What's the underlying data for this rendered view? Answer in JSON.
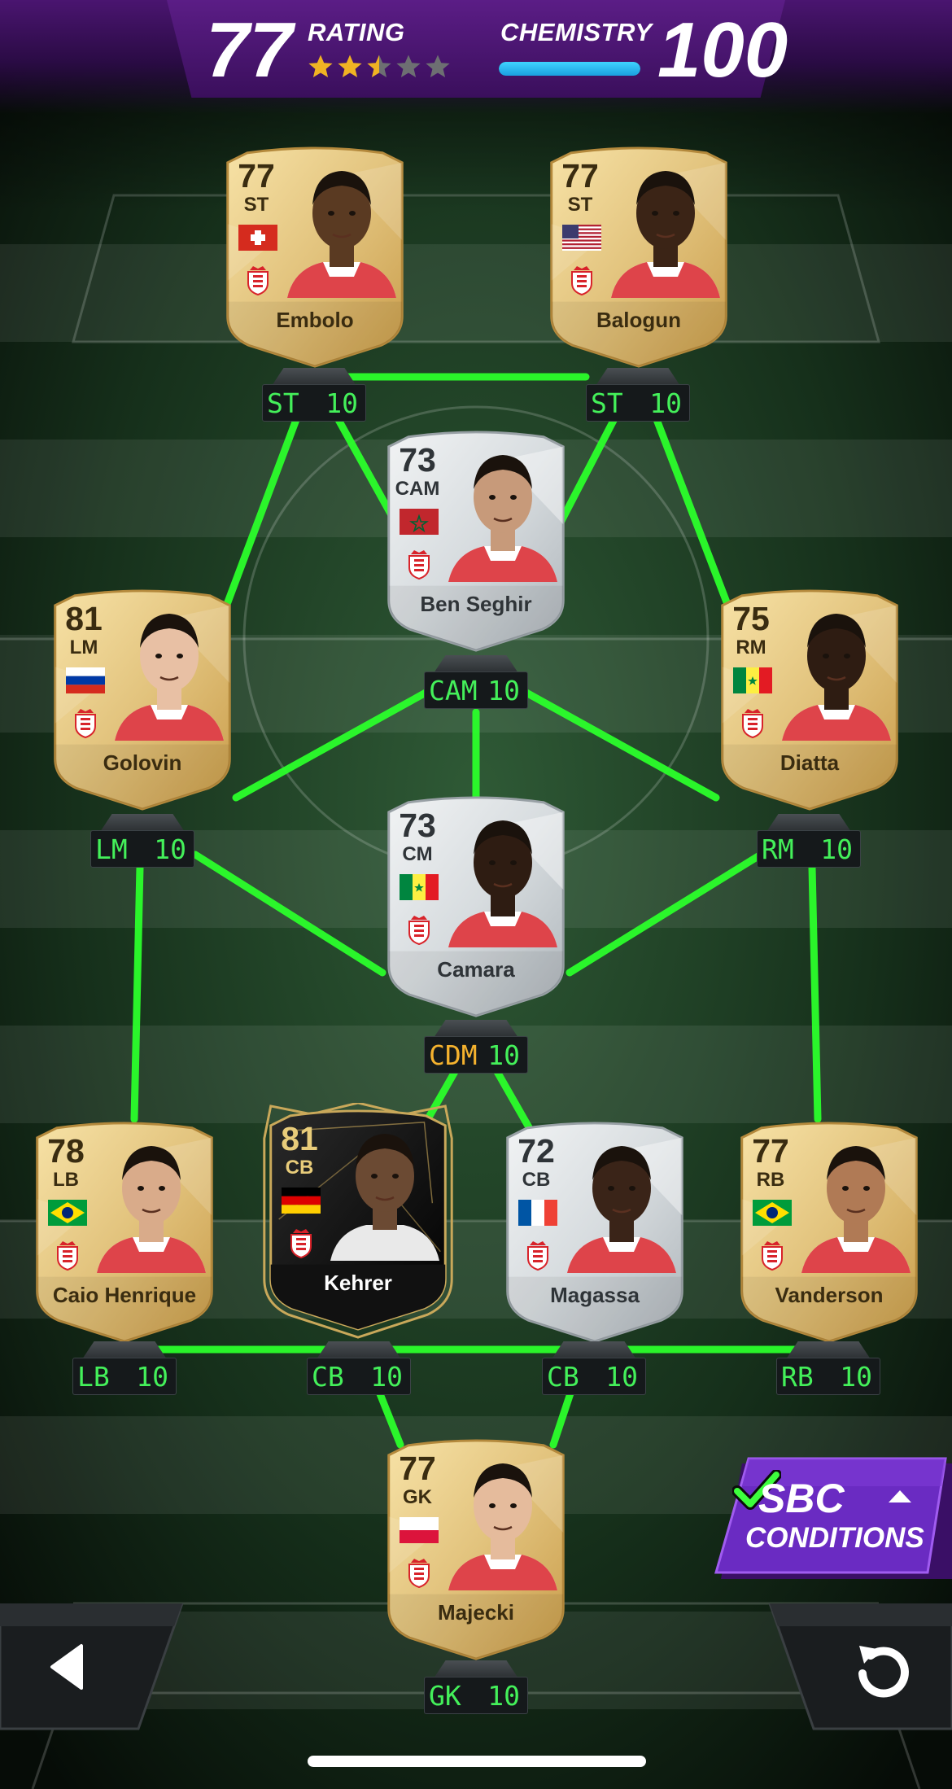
{
  "header": {
    "rating_value": "77",
    "rating_label": "RATING",
    "stars": 2.5,
    "chemistry_label": "CHEMISTRY",
    "chemistry_value": "100",
    "chemistry_fill": 1.0
  },
  "players": [
    {
      "key": "embolo",
      "name": "Embolo",
      "rating": "77",
      "pos": "ST",
      "flag": "switzerland",
      "card": "gold",
      "slot": "ST",
      "chem": "10",
      "skin": "#5a3a22"
    },
    {
      "key": "balogun",
      "name": "Balogun",
      "rating": "77",
      "pos": "ST",
      "flag": "usa",
      "card": "gold",
      "slot": "ST",
      "chem": "10",
      "skin": "#3b2416"
    },
    {
      "key": "benseghir",
      "name": "Ben Seghir",
      "rating": "73",
      "pos": "CAM",
      "flag": "morocco",
      "card": "silver",
      "slot": "CAM",
      "chem": "10",
      "skin": "#c79a7a"
    },
    {
      "key": "golovin",
      "name": "Golovin",
      "rating": "81",
      "pos": "LM",
      "flag": "russia",
      "card": "gold",
      "slot": "LM",
      "chem": "10",
      "skin": "#e8c0a4"
    },
    {
      "key": "diatta",
      "name": "Diatta",
      "rating": "75",
      "pos": "RM",
      "flag": "senegal",
      "card": "gold",
      "slot": "RM",
      "chem": "10",
      "skin": "#2e1c12"
    },
    {
      "key": "camara",
      "name": "Camara",
      "rating": "73",
      "pos": "CM",
      "flag": "senegal",
      "card": "silver",
      "slot": "CDM",
      "chem": "10",
      "skin": "#2e1c12"
    },
    {
      "key": "caio",
      "name": "Caio Henrique",
      "rating": "78",
      "pos": "LB",
      "flag": "brazil",
      "card": "gold",
      "slot": "LB",
      "chem": "10",
      "skin": "#d9ab8a"
    },
    {
      "key": "kehrer",
      "name": "Kehrer",
      "rating": "81",
      "pos": "CB",
      "flag": "germany",
      "card": "black",
      "slot": "CB",
      "chem": "10",
      "skin": "#6b4a33"
    },
    {
      "key": "magassa",
      "name": "Magassa",
      "rating": "72",
      "pos": "CB",
      "flag": "france",
      "card": "silver",
      "slot": "CB",
      "chem": "10",
      "skin": "#3a2418"
    },
    {
      "key": "vanderson",
      "name": "Vanderson",
      "rating": "77",
      "pos": "RB",
      "flag": "brazil",
      "card": "gold",
      "slot": "RB",
      "chem": "10",
      "skin": "#b07a55"
    },
    {
      "key": "majecki",
      "name": "Majecki",
      "rating": "77",
      "pos": "GK",
      "flag": "poland",
      "card": "gold",
      "slot": "GK",
      "chem": "10",
      "skin": "#e5bb9c"
    }
  ],
  "sbc": {
    "title": "SBC",
    "subtitle": "CONDITIONS"
  },
  "icons": {
    "back": "back-arrow-icon",
    "reset": "refresh-icon",
    "check": "checkmark-icon",
    "chevron": "chevron-up-icon"
  },
  "colors": {
    "link": "#2bff2b",
    "gold": "#e2c37d",
    "silver": "#d7dcdf",
    "accent": "#7b2bd4"
  }
}
